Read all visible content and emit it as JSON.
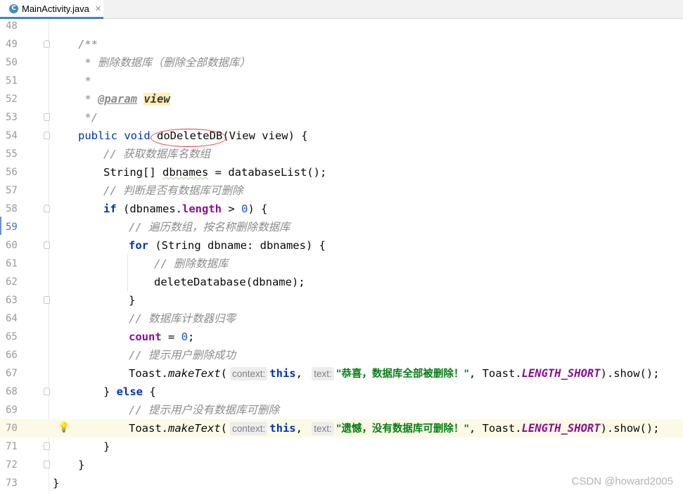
{
  "tab": {
    "icon": "C",
    "filename": "MainActivity.java",
    "close": "✕"
  },
  "line_numbers": [
    "48",
    "49",
    "50",
    "51",
    "52",
    "53",
    "54",
    "55",
    "56",
    "57",
    "58",
    "59",
    "60",
    "61",
    "62",
    "63",
    "64",
    "65",
    "66",
    "67",
    "68",
    "69",
    "70",
    "71",
    "72",
    "73"
  ],
  "code": {
    "l49": "/**",
    "l50": " * 删除数据库（删除全部数据库）",
    "l51": " *",
    "l52_star": " * ",
    "l52_tag": "@param",
    "l52_val": "view",
    "l53": " */",
    "l54_kw": "public void ",
    "l54_method": "doDeleteDB",
    "l54_rest": "(View view) {",
    "l55": "// 获取数据库名数组",
    "l56_a": "String[] ",
    "l56_var": "dbnames",
    "l56_b": " = databaseList();",
    "l57": "// 判断是否有数据库可删除",
    "l58_kw": "if",
    "l58_a": " (dbnames.",
    "l58_fld": "length",
    "l58_b": " > ",
    "l58_num": "0",
    "l58_c": ") {",
    "l59": "// 遍历数组，按名称删除数据库",
    "l60_kw": "for",
    "l60_a": " (String dbname: dbnames) {",
    "l61": "// 删除数据库",
    "l62": "deleteDatabase(dbname);",
    "l63": "}",
    "l64": "// 数据库计数器归零",
    "l65_fld": "count",
    "l65_a": " = ",
    "l65_num": "0",
    "l65_b": ";",
    "l66": "// 提示用户删除成功",
    "l67_a": "Toast.",
    "l67_m": "makeText",
    "l67_p": "(",
    "l67_hint1": "context:",
    "l67_this": "this",
    "l67_comma": ",",
    "l67_hint2": "text:",
    "l67_str": "\"恭喜，数据库全部被删除！\"",
    "l67_b": ", Toast.",
    "l67_cst": "LENGTH_SHORT",
    "l67_c": ").show();",
    "l68_a": "} ",
    "l68_kw": "else",
    "l68_b": " {",
    "l69": "// 提示用户没有数据库可删除",
    "l70_a": "Toast.",
    "l70_m": "makeText",
    "l70_p": "(",
    "l70_hint1": "context:",
    "l70_this": "this",
    "l70_comma": ",",
    "l70_hint2": "text:",
    "l70_str": "\"遗憾，没有数据库可删除！\"",
    "l70_b": ", Toast.",
    "l70_cst": "LENGTH_SHORT",
    "l70_c": ").show();",
    "l71": "}",
    "l72": "}",
    "l73": "}"
  },
  "watermark": "CSDN @howard2005",
  "colors": {
    "keyword": "#0033b3",
    "comment": "#8c8c8c",
    "string": "#067d17",
    "field": "#871094",
    "number": "#1750eb",
    "annotation_circle": "#e0393e"
  }
}
